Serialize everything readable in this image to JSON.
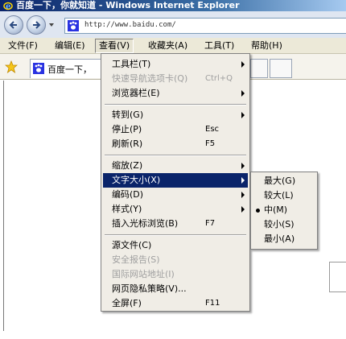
{
  "window": {
    "title": "百度一下，你就知道 - Windows Internet Explorer"
  },
  "address_bar": {
    "url": "http://www.baidu.com/"
  },
  "menubar": {
    "items": [
      {
        "label": "文件(F)"
      },
      {
        "label": "编辑(E)"
      },
      {
        "label": "查看(V)",
        "active": true
      },
      {
        "label": "收藏夹(A)"
      },
      {
        "label": "工具(T)"
      },
      {
        "label": "帮助(H)"
      }
    ]
  },
  "tab": {
    "label": "百度一下，"
  },
  "view_menu": {
    "items": [
      {
        "label": "工具栏(T)",
        "submenu": true
      },
      {
        "label": "快速导航选项卡(Q)",
        "shortcut": "Ctrl+Q",
        "disabled": true
      },
      {
        "label": "浏览器栏(E)",
        "submenu": true
      },
      {
        "label": "转到(G)",
        "submenu": true
      },
      {
        "label": "停止(P)",
        "shortcut": "Esc"
      },
      {
        "label": "刷新(R)",
        "shortcut": "F5"
      },
      {
        "label": "缩放(Z)",
        "submenu": true
      },
      {
        "label": "文字大小(X)",
        "submenu": true,
        "highlighted": true
      },
      {
        "label": "编码(D)",
        "submenu": true
      },
      {
        "label": "样式(Y)",
        "submenu": true
      },
      {
        "label": "插入光标浏览(B)",
        "shortcut": "F7"
      },
      {
        "label": "源文件(C)"
      },
      {
        "label": "安全报告(S)",
        "disabled": true
      },
      {
        "label": "国际网站地址(I)",
        "disabled": true
      },
      {
        "label": "网页隐私策略(V)..."
      },
      {
        "label": "全屏(F)",
        "shortcut": "F11"
      }
    ]
  },
  "text_size_menu": {
    "items": [
      {
        "label": "最大(G)"
      },
      {
        "label": "较大(L)"
      },
      {
        "label": "中(M)",
        "selected": true
      },
      {
        "label": "较小(S)"
      },
      {
        "label": "最小(A)"
      }
    ]
  },
  "colors": {
    "highlight": "#0a246a",
    "menu_bg": "#f0ede6",
    "titlebar": "#0a246a"
  }
}
